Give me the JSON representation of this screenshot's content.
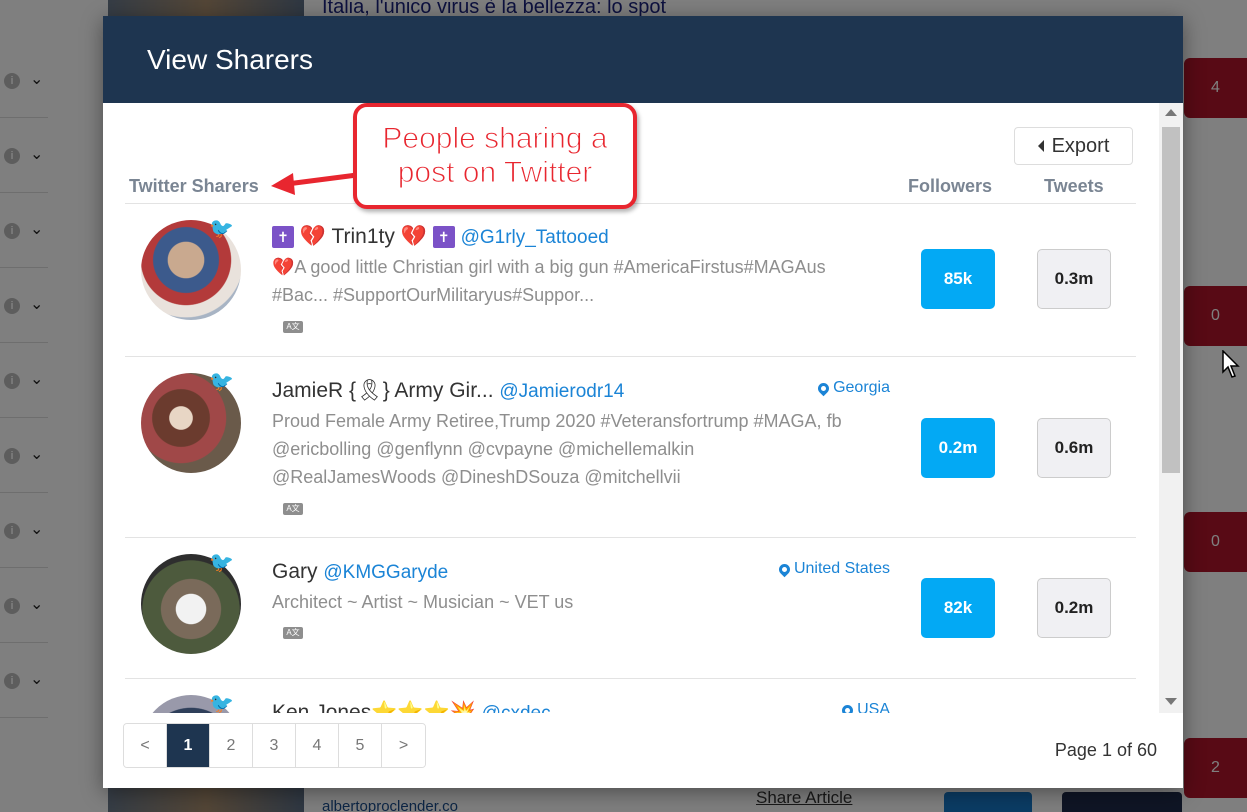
{
  "background": {
    "headline": "Italia, l'unico virus è la bellezza: lo spot",
    "share_link": "Share Article",
    "domain": "albertoproclender.co",
    "badges": [
      "4",
      "0",
      "0",
      "2"
    ]
  },
  "modal": {
    "title": "View Sharers",
    "export_label": "Export",
    "columns": {
      "sharers": "Twitter Sharers",
      "followers": "Followers",
      "tweets": "Tweets"
    },
    "callout": {
      "line1": "People sharing a",
      "line2": "post on Twitter"
    },
    "sharers": [
      {
        "name": "Trin1ty",
        "handle": "@G1rly_Tattooed",
        "location": "",
        "bio_line1": "💔A good little Christian girl with a big gun #AmericaFirstus#MAGAus",
        "bio_line2": "#Bac... #SupportOurMilitaryus#Suppor...",
        "bio_line3": "",
        "followers": "85k",
        "tweets": "0.3m"
      },
      {
        "name": "JamieR {🎗} Army Gir...",
        "handle": "@Jamierodr14",
        "location": "Georgia",
        "bio_line1": "Proud Female Army Retiree,Trump 2020 #Veteransfortrump #MAGA, fb",
        "bio_line2": "@ericbolling @genflynn @cvpayne @michellemalkin",
        "bio_line3": "@RealJamesWoods @DineshDSouza @mitchellvii",
        "followers": "0.2m",
        "tweets": "0.6m"
      },
      {
        "name": "Gary",
        "handle": "@KMGGaryde",
        "location": "United States",
        "bio_line1": "Architect ~ Artist ~ Musician ~ VET us",
        "bio_line2": "",
        "bio_line3": "",
        "followers": "82k",
        "tweets": "0.2m"
      },
      {
        "name": "Ken Jones⭐⭐⭐💥",
        "handle": "@cxdec",
        "location": "USA"
      }
    ],
    "pagination": {
      "prev": "<",
      "next": ">",
      "pages": [
        "1",
        "2",
        "3",
        "4",
        "5"
      ],
      "page_count": "Page 1 of 60"
    }
  }
}
